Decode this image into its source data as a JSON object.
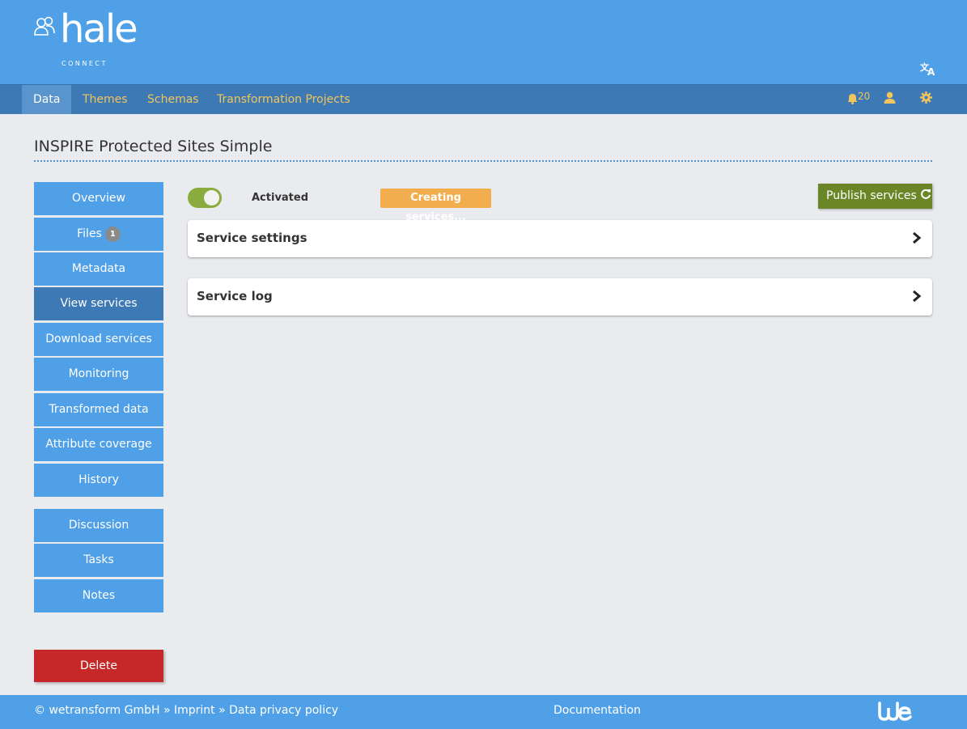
{
  "header": {
    "logo_text": "hale",
    "logo_sub": "CONNECT",
    "translate_icon": "translate-icon"
  },
  "nav": {
    "items": [
      {
        "label": "Data",
        "active": true
      },
      {
        "label": "Themes",
        "active": false
      },
      {
        "label": "Schemas",
        "active": false
      },
      {
        "label": "Transformation Projects",
        "active": false
      }
    ],
    "notification_count": "20",
    "icons": [
      "bell-icon",
      "user-icon",
      "gear-icon"
    ]
  },
  "page": {
    "title": "INSPIRE Protected Sites Simple"
  },
  "sidebar": {
    "items": [
      {
        "label": "Overview"
      },
      {
        "label": "Files",
        "badge": "1"
      },
      {
        "label": "Metadata"
      },
      {
        "label": "View services",
        "active": true
      },
      {
        "label": "Download services"
      },
      {
        "label": "Monitoring"
      },
      {
        "label": "Transformed data"
      },
      {
        "label": "Attribute coverage"
      },
      {
        "label": "History"
      },
      {
        "label": "Discussion"
      },
      {
        "label": "Tasks"
      },
      {
        "label": "Notes"
      }
    ],
    "delete_label": "Delete"
  },
  "main": {
    "toggle_label": "Activated",
    "toggle_on": true,
    "status": "Creating services...",
    "publish_label": "Publish services",
    "panels": [
      {
        "title": "Service settings"
      },
      {
        "title": "Service log"
      }
    ]
  },
  "footer": {
    "copyright": "© wetransform GmbH",
    "sep1": "»",
    "imprint": "Imprint",
    "sep2": "»",
    "privacy": "Data privacy policy",
    "documentation": "Documentation"
  },
  "colors": {
    "header_bg": "#50a0e8",
    "nav_bg": "#3d7ab5",
    "nav_text": "#f2c45c",
    "toggle_on": "#8aac3e",
    "status_badge": "#f2ad4e",
    "publish_button": "#6a8626",
    "delete_button": "#c62828"
  }
}
